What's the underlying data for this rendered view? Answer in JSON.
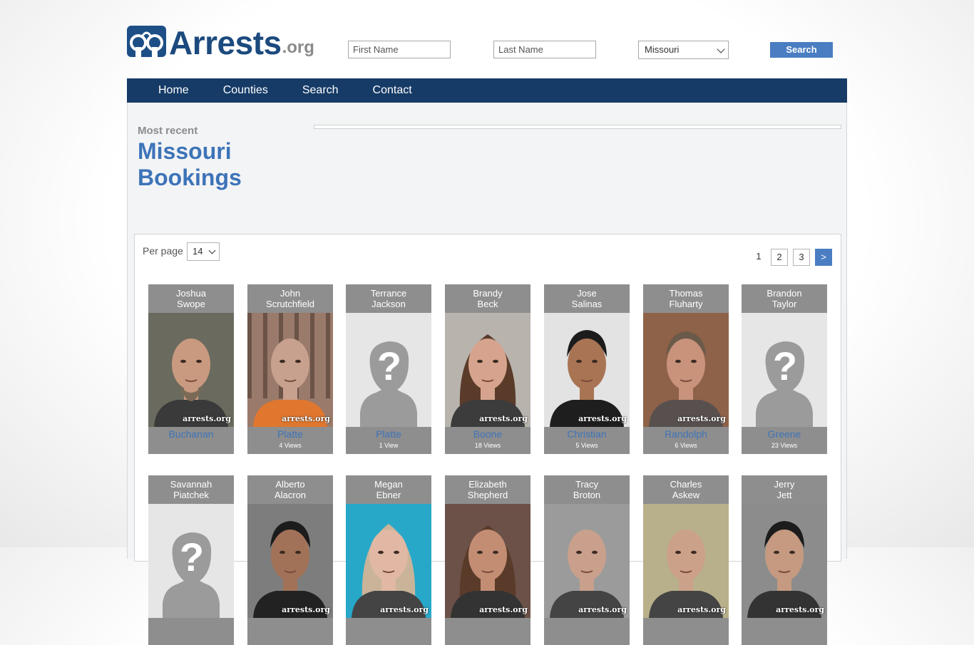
{
  "header": {
    "logo_main": "Arrests",
    "logo_tld": ".org",
    "first_name_placeholder": "First Name",
    "last_name_placeholder": "Last Name",
    "state_selected": "Missouri",
    "search_label": "Search"
  },
  "nav": {
    "items": [
      {
        "label": "Home"
      },
      {
        "label": "Counties"
      },
      {
        "label": "Search"
      },
      {
        "label": "Contact"
      }
    ]
  },
  "content": {
    "subtitle": "Most recent",
    "title_line1": "Missouri",
    "title_line2": "Bookings",
    "per_page_label": "Per page",
    "per_page_value": "14",
    "pagination": {
      "current": "1",
      "pages": [
        "2",
        "3"
      ],
      "next": ">"
    }
  },
  "watermark": "arrests.org",
  "bookings": [
    {
      "first": "Joshua",
      "last": "Swope",
      "county": "Buchanan",
      "views": "",
      "photo": "man-bald-beard",
      "bg": "#6a6b5e",
      "skin": "#c99a80",
      "shirt": "#3a3a3a"
    },
    {
      "first": "John",
      "last": "Scrutchfield",
      "county": "Platte",
      "views": "4 Views",
      "photo": "man-orange",
      "bg": "#9a7a6a",
      "skin": "#c7a18e",
      "shirt": "#e0772e"
    },
    {
      "first": "Terrance",
      "last": "Jackson",
      "county": "Platte",
      "views": "1 View",
      "photo": "placeholder",
      "bg": "#e6e6e6",
      "skin": "",
      "shirt": ""
    },
    {
      "first": "Brandy",
      "last": "Beck",
      "county": "Boone",
      "views": "18 Views",
      "photo": "woman",
      "bg": "#b8b3ad",
      "skin": "#d6a48e",
      "shirt": "#3c3c3c"
    },
    {
      "first": "Jose",
      "last": "Salinas",
      "county": "Christian",
      "views": "5 Views",
      "photo": "man-dark",
      "bg": "#e3e3e3",
      "skin": "#a97454",
      "shirt": "#1e1e1e"
    },
    {
      "first": "Thomas",
      "last": "Fluharty",
      "county": "Randolph",
      "views": "6 Views",
      "photo": "man-older",
      "bg": "#8e6248",
      "skin": "#c8927b",
      "shirt": "#58504e"
    },
    {
      "first": "Brandon",
      "last": "Taylor",
      "county": "Greene",
      "views": "23 Views",
      "photo": "placeholder",
      "bg": "#e6e6e6",
      "skin": "",
      "shirt": ""
    },
    {
      "first": "Savannah",
      "last": "Piatchek",
      "county": "",
      "views": "",
      "photo": "placeholder",
      "bg": "#e6e6e6",
      "skin": "",
      "shirt": ""
    },
    {
      "first": "Alberto",
      "last": "Alacron",
      "county": "",
      "views": "",
      "photo": "man-dark-hair",
      "bg": "#7d7d7d",
      "skin": "#a27258",
      "shirt": "#222"
    },
    {
      "first": "Megan",
      "last": "Ebner",
      "county": "",
      "views": "",
      "photo": "woman-blonde",
      "bg": "#27a8c8",
      "skin": "#e0b8a3",
      "shirt": "#444"
    },
    {
      "first": "Elizabeth",
      "last": "Shepherd",
      "county": "",
      "views": "",
      "photo": "woman-brown",
      "bg": "#6c5148",
      "skin": "#c38d74",
      "shirt": "#333"
    },
    {
      "first": "Tracy",
      "last": "Broton",
      "county": "",
      "views": "",
      "photo": "man-bald",
      "bg": "#9b9b9b",
      "skin": "#c9a08c",
      "shirt": "#444"
    },
    {
      "first": "Charles",
      "last": "Askew",
      "county": "",
      "views": "",
      "photo": "man-bald",
      "bg": "#b8b08a",
      "skin": "#cba189",
      "shirt": "#444"
    },
    {
      "first": "Jerry",
      "last": "Jett",
      "county": "",
      "views": "",
      "photo": "man-dark-hair",
      "bg": "#8c8c8c",
      "skin": "#c59a80",
      "shirt": "#333"
    }
  ]
}
